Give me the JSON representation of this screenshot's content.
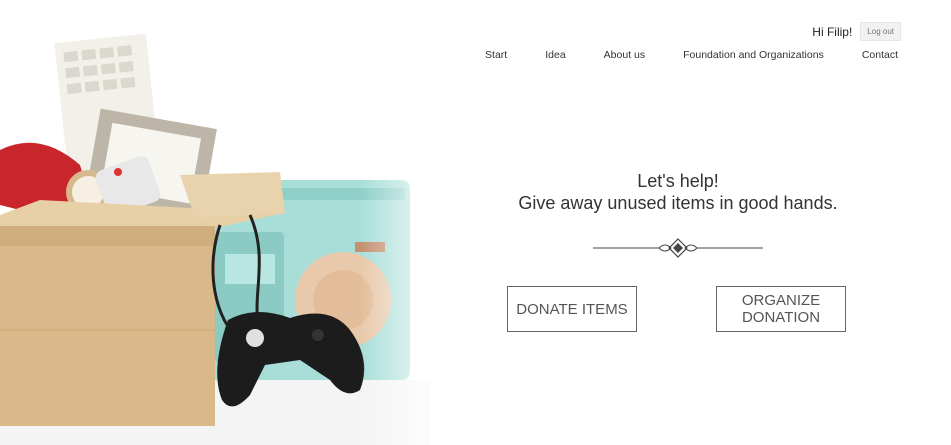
{
  "header": {
    "greeting": "Hi Filip!",
    "logout_label": "Log out",
    "nav": [
      {
        "label": "Start"
      },
      {
        "label": "Idea"
      },
      {
        "label": "About us"
      },
      {
        "label": "Foundation and Organizations"
      },
      {
        "label": "Contact"
      }
    ]
  },
  "hero": {
    "line1": "Let's help!",
    "line2": "Give away unused items in good hands.",
    "donate_label": "DONATE ITEMS",
    "organize_label": "ORGANIZE DONATION"
  },
  "colors": {
    "text": "#333333",
    "button_border": "#666666",
    "box": "#d9b98a",
    "radio": "#a7ded9",
    "phone": "#c8262b"
  },
  "icons": {
    "ornament": "ornament-divider-icon"
  }
}
